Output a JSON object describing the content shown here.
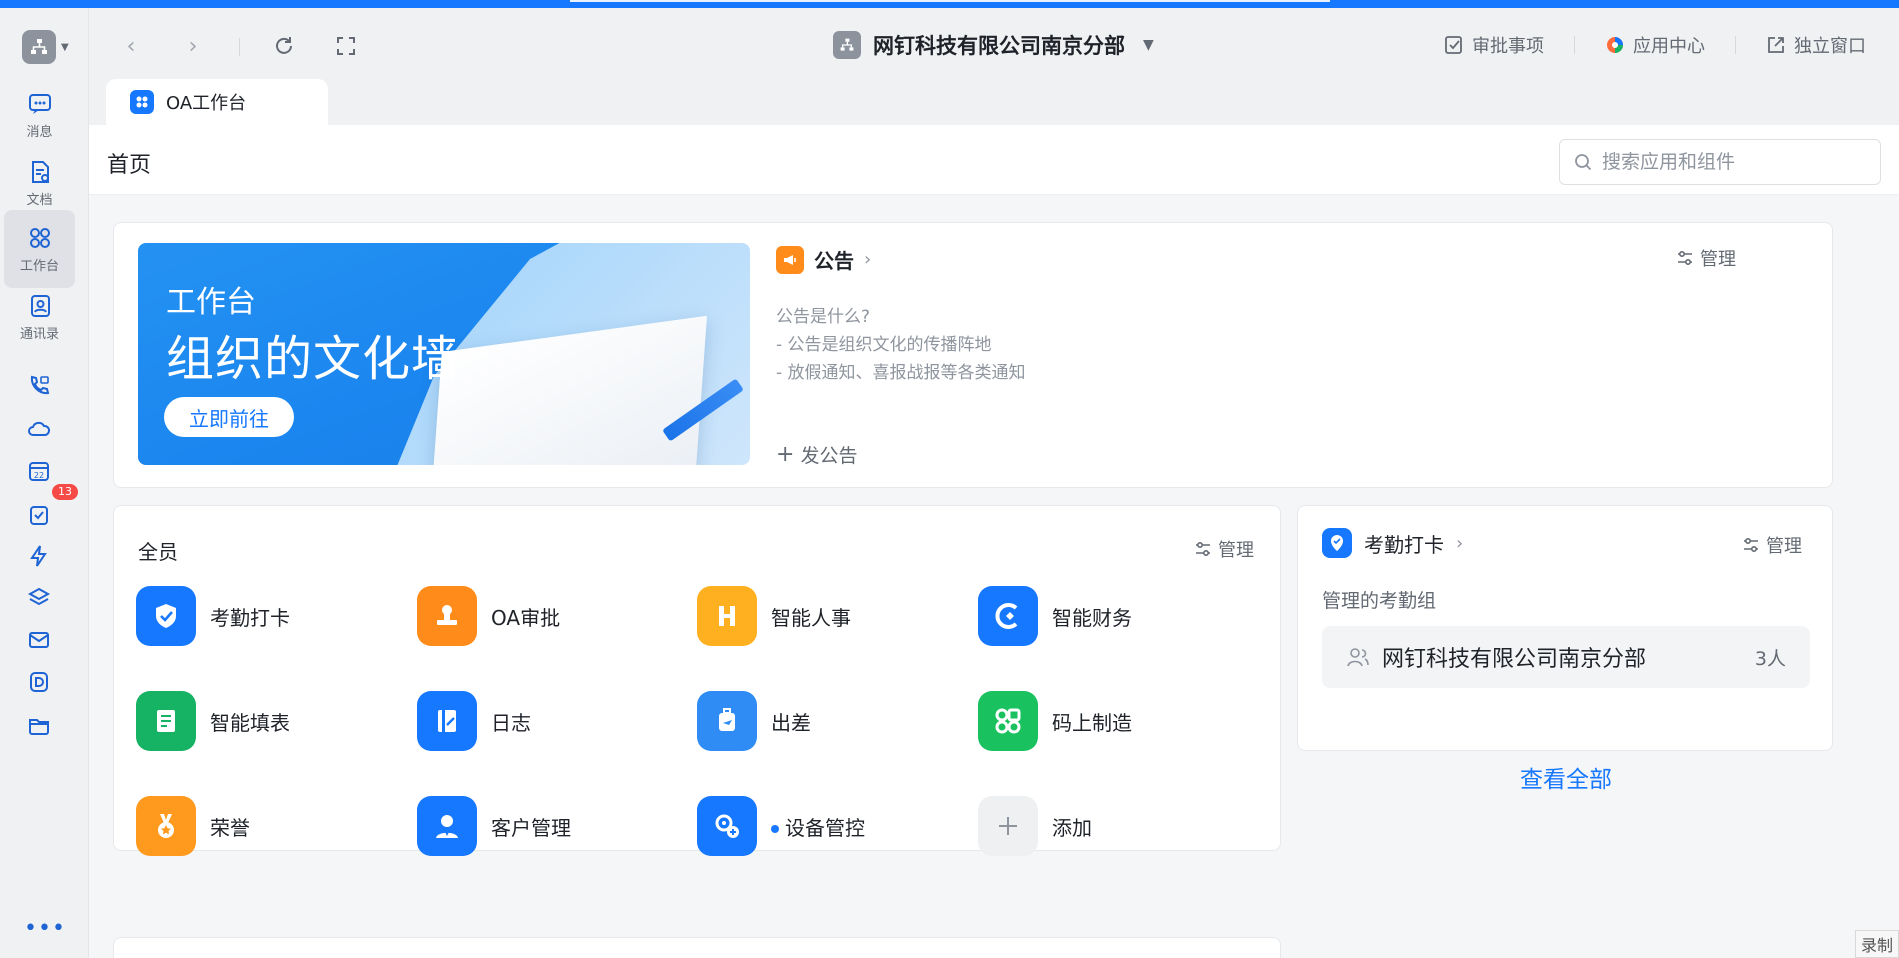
{
  "org": {
    "name": "网钉科技有限公司南京分部"
  },
  "rail": {
    "items": [
      {
        "label": "消息",
        "icon": "chat-icon"
      },
      {
        "label": "文档",
        "icon": "document-icon"
      },
      {
        "label": "工作台",
        "icon": "workbench-icon"
      },
      {
        "label": "通讯录",
        "icon": "contacts-icon"
      }
    ],
    "todo_badge": "13",
    "calendar_day": "22"
  },
  "header": {
    "actions": [
      {
        "label": "审批事项",
        "icon": "approval-check-icon"
      },
      {
        "label": "应用中心",
        "icon": "app-center-icon"
      },
      {
        "label": "独立窗口",
        "icon": "external-window-icon"
      }
    ]
  },
  "tab": {
    "label": "OA工作台"
  },
  "page": {
    "title": "首页",
    "search_placeholder": "搜索应用和组件"
  },
  "banner": {
    "line1": "工作台",
    "line2": "组织的文化墙",
    "button": "立即前往"
  },
  "notice": {
    "title": "公告",
    "manage": "管理",
    "lines": [
      "公告是什么?",
      "- 公告是组织文化的传播阵地",
      "- 放假通知、喜报战报等各类通知"
    ],
    "post": "发公告"
  },
  "apps": {
    "title": "全员",
    "manage": "管理",
    "items": [
      {
        "name": "考勤打卡",
        "color": "#1677ff"
      },
      {
        "name": "OA审批",
        "color": "#ff8c1a"
      },
      {
        "name": "智能人事",
        "color": "#ffb020"
      },
      {
        "name": "智能财务",
        "color": "#1677ff"
      },
      {
        "name": "智能填表",
        "color": "#16b364"
      },
      {
        "name": "日志",
        "color": "#1677ff"
      },
      {
        "name": "出差",
        "color": "#2f8cf5"
      },
      {
        "name": "码上制造",
        "color": "#19c15f"
      },
      {
        "name": "荣誉",
        "color": "#ff9a1f"
      },
      {
        "name": "客户管理",
        "color": "#1677ff"
      },
      {
        "name": "设备管控",
        "color": "#1677ff"
      },
      {
        "name": "添加",
        "color": "#eef0f2"
      }
    ]
  },
  "attendance": {
    "title": "考勤打卡",
    "manage": "管理",
    "subtitle": "管理的考勤组",
    "group_name": "网钉科技有限公司南京分部",
    "group_count": "3人",
    "view_all": "查看全部"
  },
  "corner": {
    "label": "录制"
  }
}
